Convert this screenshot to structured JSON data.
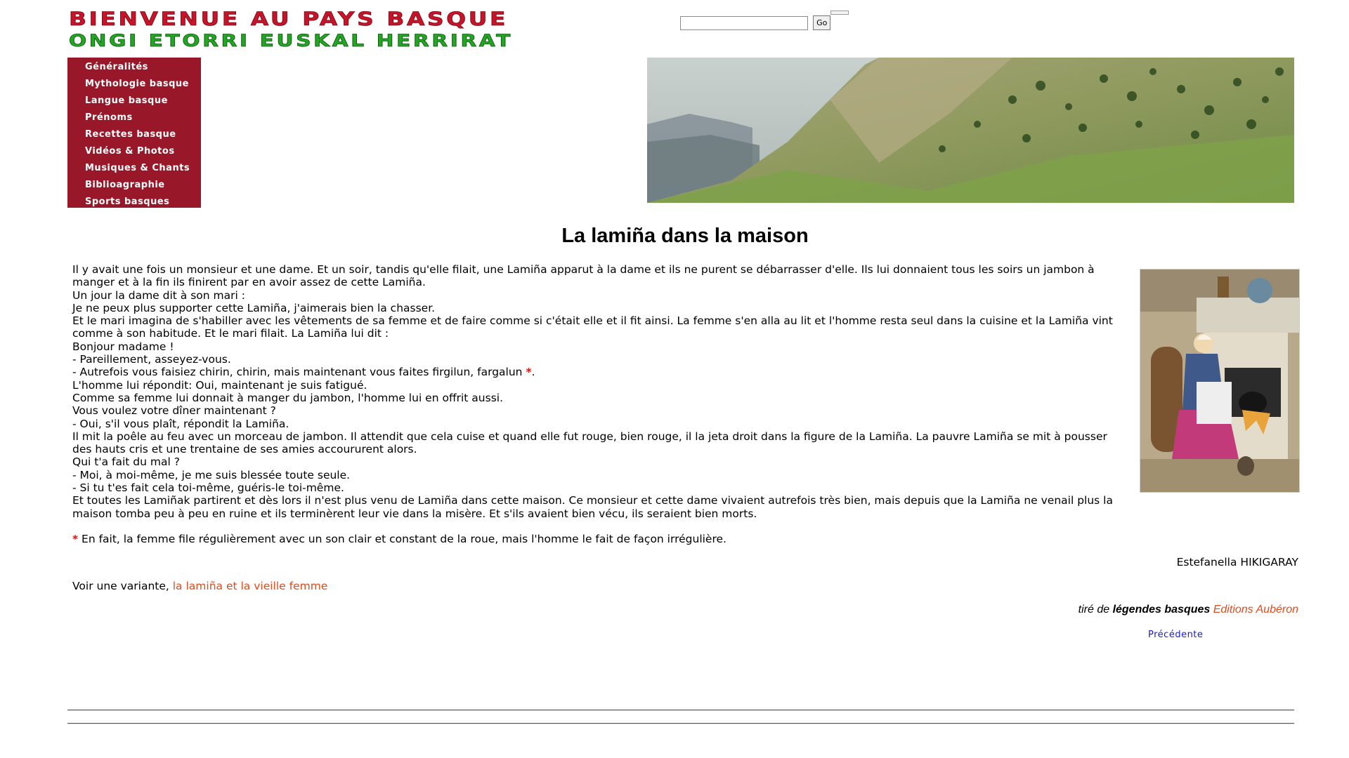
{
  "header": {
    "title_fr": "BIENVENUE AU PAYS BASQUE",
    "title_eu": "ONGI ETORRI EUSKAL HERRIRAT"
  },
  "search": {
    "value": "",
    "button": "Go"
  },
  "menu": [
    "Généralités",
    "Mythologie basque",
    "Langue basque",
    "Prénoms",
    "Recettes basque",
    "Vidéos & Photos",
    "Musiques & Chants",
    "Biblioagraphie",
    "Sports basques"
  ],
  "article": {
    "title": "La lamiña dans la maison",
    "lines": [
      "Il y avait une fois un monsieur et une dame. Et un soir, tandis qu'elle filait, une Lamiña apparut à la dame et ils ne purent se débarrasser d'elle. Ils lui donnaient tous les soirs un jambon à manger et à la fin ils finirent par en avoir assez de cette Lamiña.",
      "Un jour la dame dit à son mari :",
      "Je ne peux plus supporter cette Lamiña, j'aimerais bien la chasser.",
      "Et le mari imagina de s'habiller avec les vêtements de sa femme et de faire comme si c'était elle et il fit ainsi. La femme s'en alla au lit et l'homme resta seul dans la cuisine et la Lamiña vint comme à son habitude. Et le mari filait. La Lamiña lui dit :",
      "Bonjour madame !",
      "- Pareillement, asseyez-vous.",
      "- Autrefois vous faisiez chirin, chirin, mais maintenant vous faites firgilun, fargalun",
      "L'homme lui répondit: Oui, maintenant je suis fatigué.",
      "Comme sa femme lui donnait à manger du jambon, l'homme lui en offrit aussi.",
      "Vous voulez votre dîner maintenant ?",
      "- Oui, s'il vous plaît, répondit la Lamiña.",
      "Il mit la poêle au feu avec un morceau de jambon. Il attendit que cela cuise et quand elle fut rouge, bien rouge, il la jeta droit dans la figure de la Lamiña. La pauvre Lamiña se mit à pousser des hauts cris et une trentaine de ses amies accoururent alors.",
      "Qui t'a fait du mal ?",
      "- Moi, à moi-même, je me suis blessée toute seule.",
      "- Si tu t'es fait cela toi-même, guéris-le toi-même.",
      "Et toutes les Lamiñak partirent et dès lors il n'est plus venu de Lamiña dans cette maison. Ce monsieur et cette dame vivaient autrefois très bien, mais depuis que la Lamiña ne venail plus la maison tomba peu à peu en ruine et ils terminèrent leur vie dans la misère. Et s'ils avaient bien vécu, ils seraient bien morts."
    ],
    "asterisk": "*",
    "period": ".",
    "footnote": "En fait, la femme file régulièrement avec un son clair et constant de la roue, mais l'homme le fait de façon irrégulière.",
    "author": "Estefanella HIKIGARAY",
    "variant_prefix": "Voir une variante,",
    "variant_link": "la lamiña et la vieille femme",
    "source_prefix": "tiré de",
    "source_book": "légendes basques",
    "source_publisher": "Editions Aubéron",
    "prev_link": "Précédente"
  },
  "colors": {
    "menu_bg": "#98182a",
    "link": "#e24a1c",
    "prev_link": "#1a1ad6",
    "asterisk": "#d21919"
  }
}
